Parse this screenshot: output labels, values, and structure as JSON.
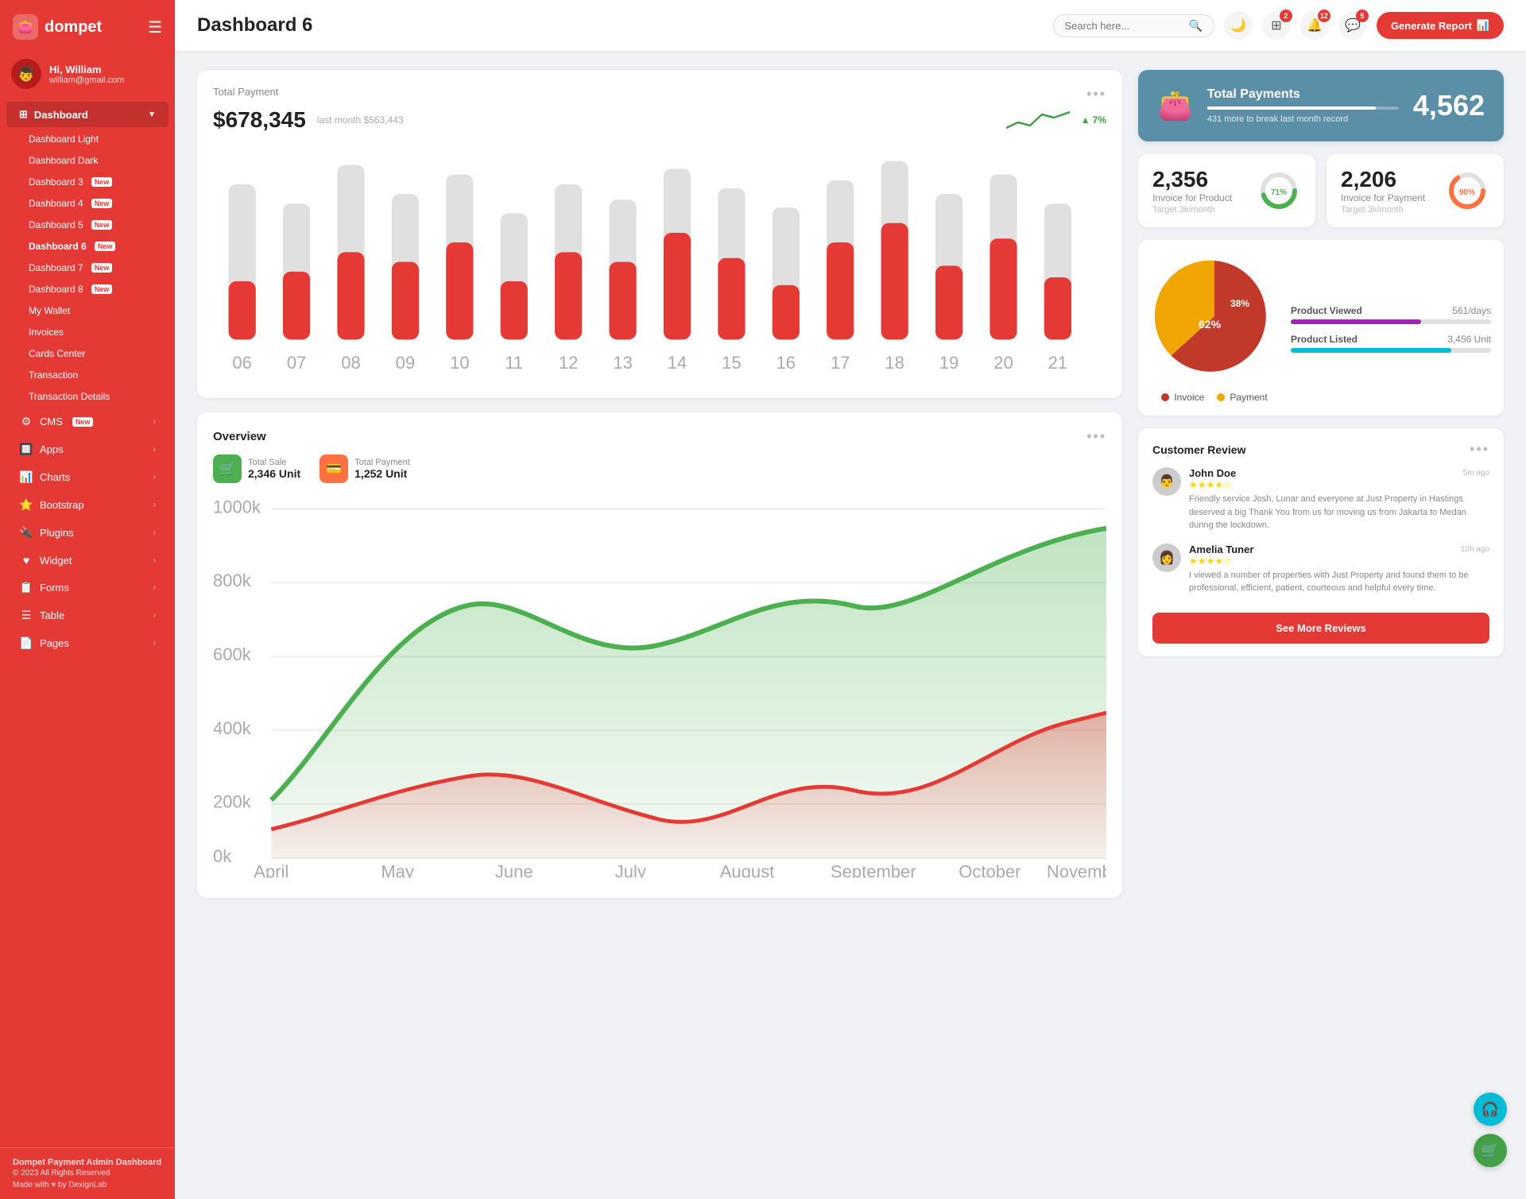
{
  "sidebar": {
    "logo_text": "dompet",
    "user": {
      "name": "Hi, William",
      "email": "william@gmail.com"
    },
    "dashboard_menu": "Dashboard",
    "nav_items": [
      {
        "label": "Dashboard Light",
        "badge": null
      },
      {
        "label": "Dashboard Dark",
        "badge": null
      },
      {
        "label": "Dashboard 3",
        "badge": "New"
      },
      {
        "label": "Dashboard 4",
        "badge": "New"
      },
      {
        "label": "Dashboard 5",
        "badge": "New"
      },
      {
        "label": "Dashboard 6",
        "badge": "New",
        "active": true
      },
      {
        "label": "Dashboard 7",
        "badge": "New"
      },
      {
        "label": "Dashboard 8",
        "badge": "New"
      },
      {
        "label": "My Wallet",
        "badge": null
      },
      {
        "label": "Invoices",
        "badge": null
      },
      {
        "label": "Cards Center",
        "badge": null
      },
      {
        "label": "Transaction",
        "badge": null
      },
      {
        "label": "Transaction Details",
        "badge": null
      }
    ],
    "menu_sections": [
      {
        "icon": "⚙",
        "label": "CMS",
        "badge": "New",
        "has_arrow": true
      },
      {
        "icon": "🔲",
        "label": "Apps",
        "badge": null,
        "has_arrow": true
      },
      {
        "icon": "📊",
        "label": "Charts",
        "badge": null,
        "has_arrow": true
      },
      {
        "icon": "⭐",
        "label": "Bootstrap",
        "badge": null,
        "has_arrow": true
      },
      {
        "icon": "🔌",
        "label": "Plugins",
        "badge": null,
        "has_arrow": true
      },
      {
        "icon": "♥",
        "label": "Widget",
        "badge": null,
        "has_arrow": true
      },
      {
        "icon": "📋",
        "label": "Forms",
        "badge": null,
        "has_arrow": true
      },
      {
        "icon": "☰",
        "label": "Table",
        "badge": null,
        "has_arrow": true
      },
      {
        "icon": "📄",
        "label": "Pages",
        "badge": null,
        "has_arrow": true
      }
    ],
    "footer_title": "Dompet Payment Admin Dashboard",
    "footer_copy": "© 2023 All Rights Reserved",
    "footer_made": "Made with 🤍 by DexignLab"
  },
  "topbar": {
    "title": "Dashboard 6",
    "search_placeholder": "Search here...",
    "badges": {
      "apps": "2",
      "notifications": "12",
      "messages": "5"
    },
    "generate_btn": "Generate Report"
  },
  "total_payment": {
    "label": "Total Payment",
    "amount": "$678,345",
    "last_month": "last month $563,443",
    "trend": "7%",
    "trend_direction": "up"
  },
  "total_payments_blue": {
    "title": "Total Payments",
    "sub": "431 more to break last month record",
    "number": "4,562",
    "progress": 88
  },
  "invoice_product": {
    "number": "2,356",
    "label": "Invoice for Product",
    "sub": "Target 3k/month",
    "percent": 71
  },
  "invoice_payment": {
    "number": "2,206",
    "label": "Invoice for Payment",
    "sub": "Target 3k/month",
    "percent": 90
  },
  "overview": {
    "title": "Overview",
    "total_sale_label": "Total Sale",
    "total_sale_value": "2,346 Unit",
    "total_payment_label": "Total Payment",
    "total_payment_value": "1,252 Unit"
  },
  "pie_chart": {
    "invoice_pct": 62,
    "payment_pct": 38,
    "invoice_label": "Invoice",
    "payment_label": "Payment",
    "invoice_color": "#c0392b",
    "payment_color": "#f0a500"
  },
  "product_stats": [
    {
      "label": "Product Viewed",
      "value": "561/days",
      "color": "#9c27b0",
      "pct": 65
    },
    {
      "label": "Product Listed",
      "value": "3,456 Unit",
      "color": "#00bcd4",
      "pct": 80
    }
  ],
  "customer_review": {
    "title": "Customer Review",
    "reviews": [
      {
        "name": "John Doe",
        "stars": 4,
        "time": "5m ago",
        "text": "Friendly service Josh, Lunar and everyone at Just Property in Hastings deserved a big Thank You from us for moving us from Jakarta to Medan during the lockdown.",
        "avatar": "👨"
      },
      {
        "name": "Amelia Tuner",
        "stars": 4,
        "time": "10h ago",
        "text": "I viewed a number of properties with Just Property and found them to be professional, efficient, patient, courteous and helpful every time.",
        "avatar": "👩"
      }
    ],
    "see_more_btn": "See More Reviews"
  },
  "colors": {
    "primary": "#e53935",
    "sidebar_bg": "#e53935",
    "blue_card": "#5b8fa8",
    "green": "#43a047",
    "orange": "#ff7043"
  }
}
